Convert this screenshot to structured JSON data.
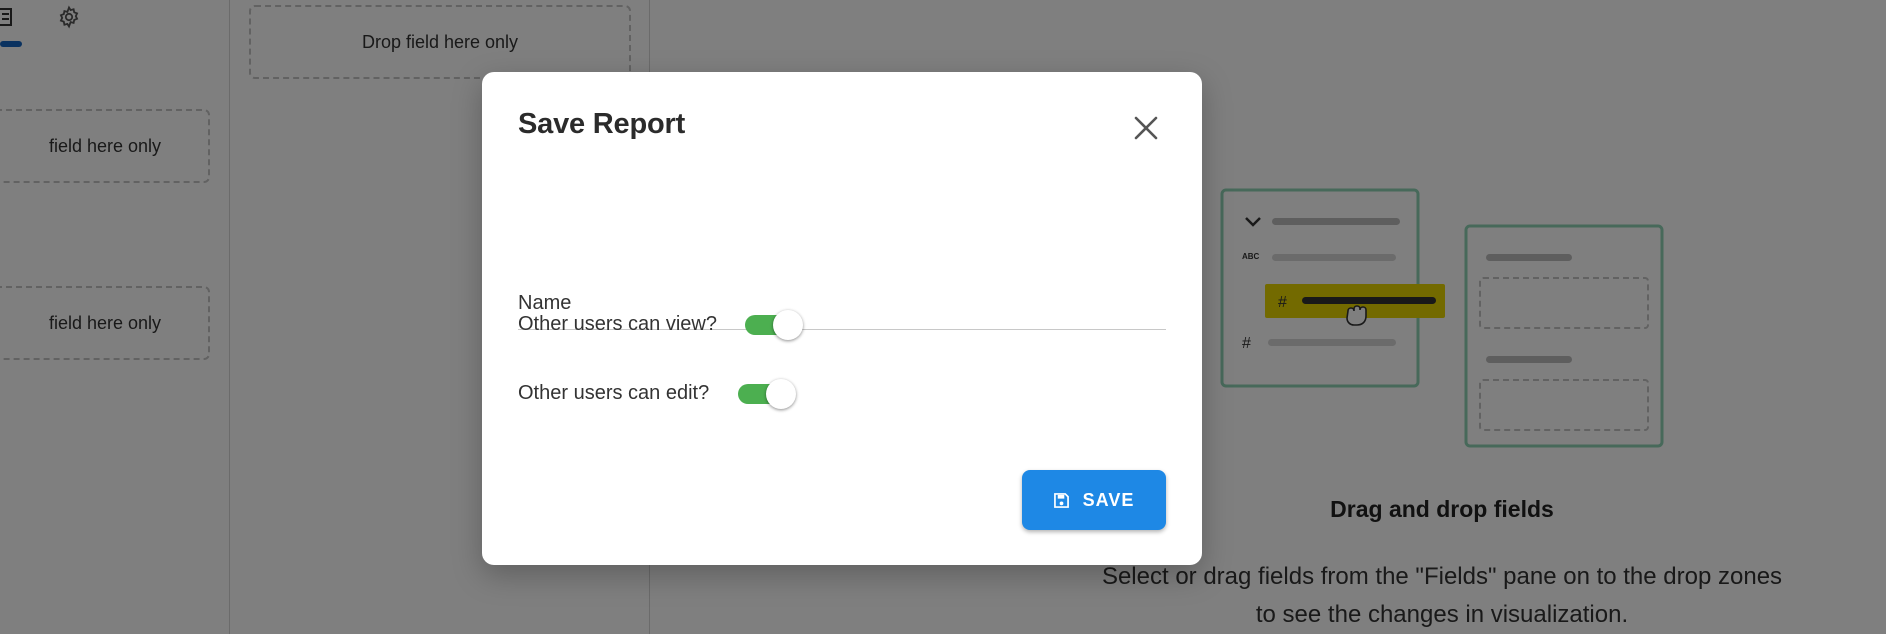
{
  "background": {
    "left_pane": {
      "icons": [
        "list-icon",
        "gear-icon"
      ],
      "drop_zones": [
        {
          "label": "field here only"
        },
        {
          "label": "field here only"
        }
      ]
    },
    "middle_pane": {
      "drop_zone_label": "Drop field here only"
    },
    "empty_state": {
      "illustration_labels": {
        "abc": "ABC",
        "hash": "#"
      },
      "title": "Drag and drop fields",
      "description_line1": "Select or drag fields from the \"Fields\" pane on to the drop zones",
      "description_line2": "to see the changes in visualization."
    }
  },
  "dialog": {
    "title": "Save Report",
    "close_icon": "close-icon",
    "name_field": {
      "label": "Name",
      "value": ""
    },
    "toggles": [
      {
        "label": "Other users can view?",
        "checked": true
      },
      {
        "label": "Other users can edit?",
        "checked": true
      }
    ],
    "save_button": {
      "label": "SAVE",
      "icon": "save-icon"
    }
  },
  "colors": {
    "toggle_on": "#4caf50",
    "primary_button": "#1e88e5",
    "tab_indicator": "#1565c0",
    "highlight_field": "#e6d400",
    "illustration_border": "#8fd3b5"
  }
}
